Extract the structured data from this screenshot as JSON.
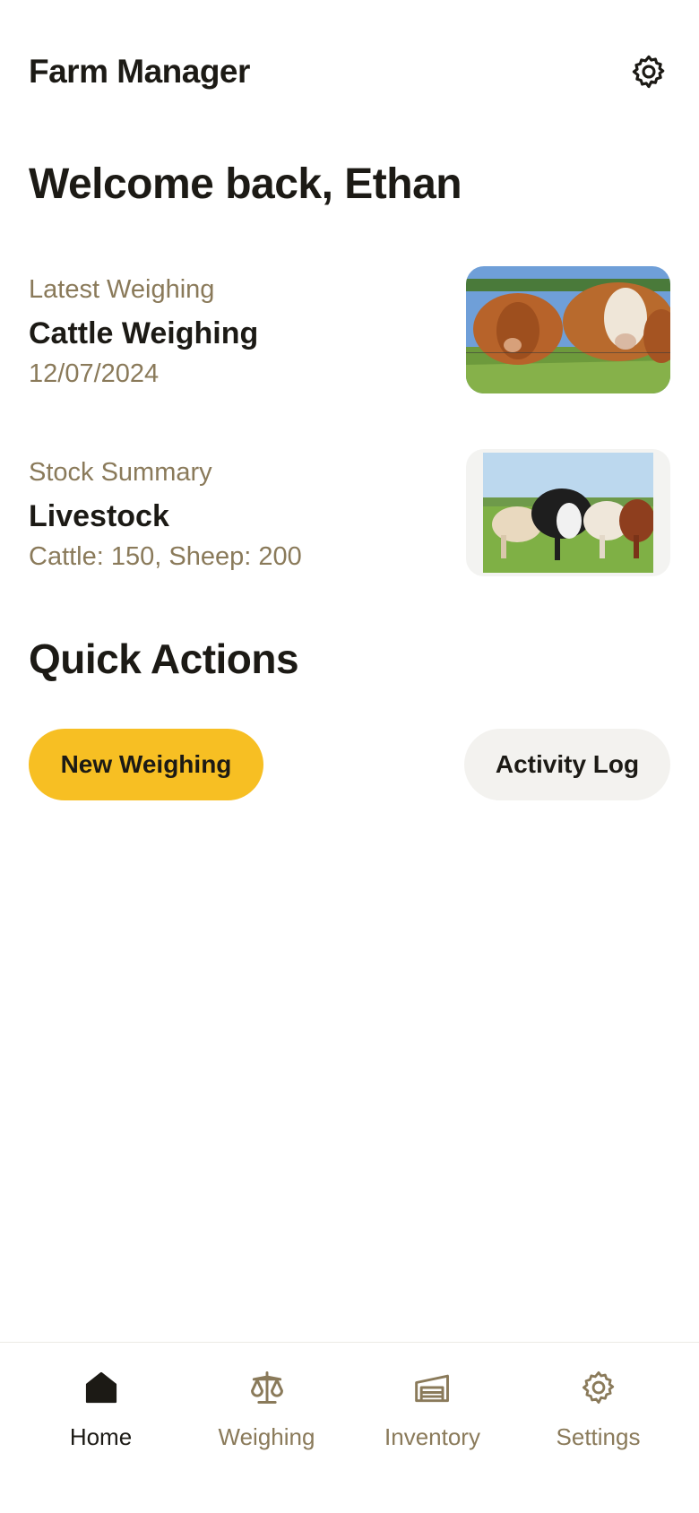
{
  "header": {
    "title": "Farm Manager",
    "settings_icon": "gear-icon"
  },
  "welcome": "Welcome back, Ethan",
  "cards": [
    {
      "kicker": "Latest Weighing",
      "title": "Cattle Weighing",
      "subtitle": "12/07/2024",
      "image": "brown-and-white-cattle-photo"
    },
    {
      "kicker": "Stock Summary",
      "title": "Livestock",
      "subtitle": "Cattle: 150, Sheep: 200",
      "image": "mixed-cattle-herd-photo"
    }
  ],
  "quick_actions": {
    "title": "Quick Actions",
    "primary_label": "New Weighing",
    "secondary_label": "Activity Log",
    "primary_color": "#f7bf23"
  },
  "nav": {
    "active": "Home",
    "items": [
      {
        "label": "Home",
        "icon": "home-icon"
      },
      {
        "label": "Weighing",
        "icon": "scale-icon"
      },
      {
        "label": "Inventory",
        "icon": "warehouse-icon"
      },
      {
        "label": "Settings",
        "icon": "gear-icon"
      }
    ]
  },
  "colors": {
    "accent": "#f7bf23",
    "muted_text": "#8a7a5a",
    "text": "#1c1a15"
  }
}
